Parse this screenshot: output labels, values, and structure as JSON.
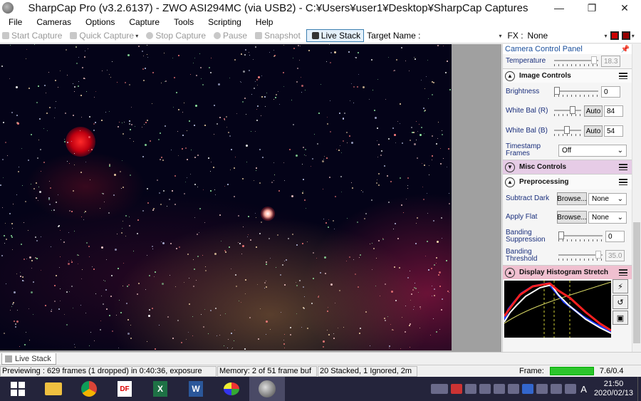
{
  "window": {
    "title": "SharpCap Pro (v3.2.6137) - ZWO ASI294MC (via USB2) - C:¥Users¥user1¥Desktop¥SharpCap Captures",
    "minimize_icon": "minimize-icon",
    "restore_glyph": "❐",
    "close_glyph": "✕",
    "minimize_glyph": "—"
  },
  "menu": [
    "File",
    "Cameras",
    "Options",
    "Capture",
    "Tools",
    "Scripting",
    "Help"
  ],
  "toolbar": {
    "start_capture": "Start Capture",
    "quick_capture": "Quick Capture",
    "stop_capture": "Stop Capture",
    "pause": "Pause",
    "snapshot": "Snapshot",
    "live_stack": "Live Stack",
    "target_name_label": "Target Name :",
    "target_name_value": "",
    "fx_label": "FX :",
    "fx_value": "None"
  },
  "panel": {
    "title": "Camera Control Panel",
    "temperature_label": "Temperature",
    "temperature_value": "18.3",
    "image_controls": {
      "title": "Image Controls",
      "brightness_label": "Brightness",
      "brightness_value": "0",
      "wb_r_label": "White Bal (R)",
      "wb_r_auto": "Auto",
      "wb_r_value": "84",
      "wb_b_label": "White Bal (B)",
      "wb_b_auto": "Auto",
      "wb_b_value": "54",
      "timestamp_label": "Timestamp Frames",
      "timestamp_value": "Off"
    },
    "misc_controls": {
      "title": "Misc Controls"
    },
    "preprocessing": {
      "title": "Preprocessing",
      "subtract_dark_label": "Subtract Dark",
      "subtract_dark_browse": "Browse...",
      "subtract_dark_value": "None",
      "apply_flat_label": "Apply Flat",
      "apply_flat_browse": "Browse...",
      "apply_flat_value": "None",
      "banding_suppression_label": "Banding Suppression",
      "banding_suppression_value": "0",
      "banding_threshold_label": "Banding Threshold",
      "banding_threshold_value": "35.0"
    },
    "histogram": {
      "title": "Display Histogram Stretch"
    }
  },
  "tabs": {
    "live_stack": "Live Stack"
  },
  "status": {
    "previewing": "Previewing : 629 frames (1 dropped) in 0:40:36, exposure",
    "memory": "Memory: 2 of 51 frame buf",
    "stacked": "20 Stacked, 1 Ignored, 2m",
    "frame_label": "Frame:",
    "frame_value": "7.6/0.4"
  },
  "clock": {
    "time": "21:50",
    "date": "2020/02/13"
  },
  "ime": "A",
  "colors": {
    "accent": "#3c7fb1",
    "frame_bar": "#2cc62c",
    "taskbar": "#24243b"
  }
}
